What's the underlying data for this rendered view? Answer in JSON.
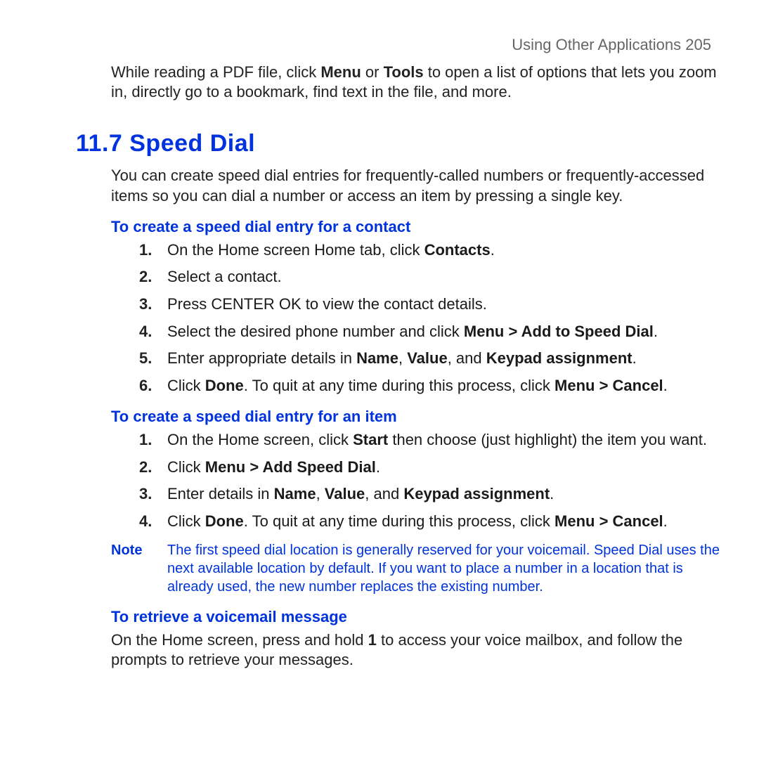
{
  "header": {
    "running_title": "Using Other Applications",
    "page_number": "205"
  },
  "intro": {
    "p_a": "While reading a PDF file, click ",
    "b_menu": "Menu",
    "or": " or ",
    "b_tools": "Tools",
    "p_b": " to open a list of options that lets you zoom in, directly go to a bookmark, find text in the file, and more."
  },
  "section": {
    "title": "11.7  Speed Dial",
    "intro": "You can create speed dial entries for frequently-called numbers or frequently-accessed items so you can dial a number or access an item by pressing a single key."
  },
  "sub1": {
    "heading": "To create a speed dial entry for a contact",
    "num1": "1.",
    "s1a": "On the Home screen Home tab, click ",
    "s1b": "Contacts",
    "s1c": ".",
    "num2": "2.",
    "s2": "Select a contact.",
    "num3": "3.",
    "s3": "Press CENTER OK to view the contact details.",
    "num4": "4.",
    "s4a": "Select the desired phone number and click ",
    "s4b": "Menu > Add to Speed Dial",
    "s4c": ".",
    "num5": "5.",
    "s5a": "Enter appropriate details in ",
    "s5b": "Name",
    "s5c": ", ",
    "s5d": "Value",
    "s5e": ", and ",
    "s5f": "Keypad assignment",
    "s5g": ".",
    "num6": "6.",
    "s6a": "Click ",
    "s6b": "Done",
    "s6c": ". To quit at any time during this process, click ",
    "s6d": "Menu > Cancel",
    "s6e": "."
  },
  "sub2": {
    "heading": "To create a speed dial entry for an item",
    "num1": "1.",
    "s1a": "On the Home screen, click ",
    "s1b": "Start",
    "s1c": " then choose (just highlight) the item you want.",
    "num2": "2.",
    "s2a": "Click ",
    "s2b": "Menu > Add Speed Dial",
    "s2c": ".",
    "num3": "3.",
    "s3a": "Enter details in ",
    "s3b": "Name",
    "s3c": ", ",
    "s3d": "Value",
    "s3e": ", and ",
    "s3f": "Keypad assignment",
    "s3g": ".",
    "num4": "4.",
    "s4a": "Click ",
    "s4b": "Done",
    "s4c": ". To quit at any time during this process, click ",
    "s4d": "Menu > Cancel",
    "s4e": "."
  },
  "note": {
    "label": "Note",
    "body": "The first speed dial location is generally reserved for your voicemail. Speed Dial uses the next available location by default. If you want to place a number in a location that is already used, the new number replaces the existing number."
  },
  "sub3": {
    "heading": "To retrieve a voicemail message",
    "p_a": "On the Home screen, press and hold ",
    "p_b": "1",
    "p_c": " to access your voice mailbox, and follow the prompts to retrieve your messages."
  }
}
